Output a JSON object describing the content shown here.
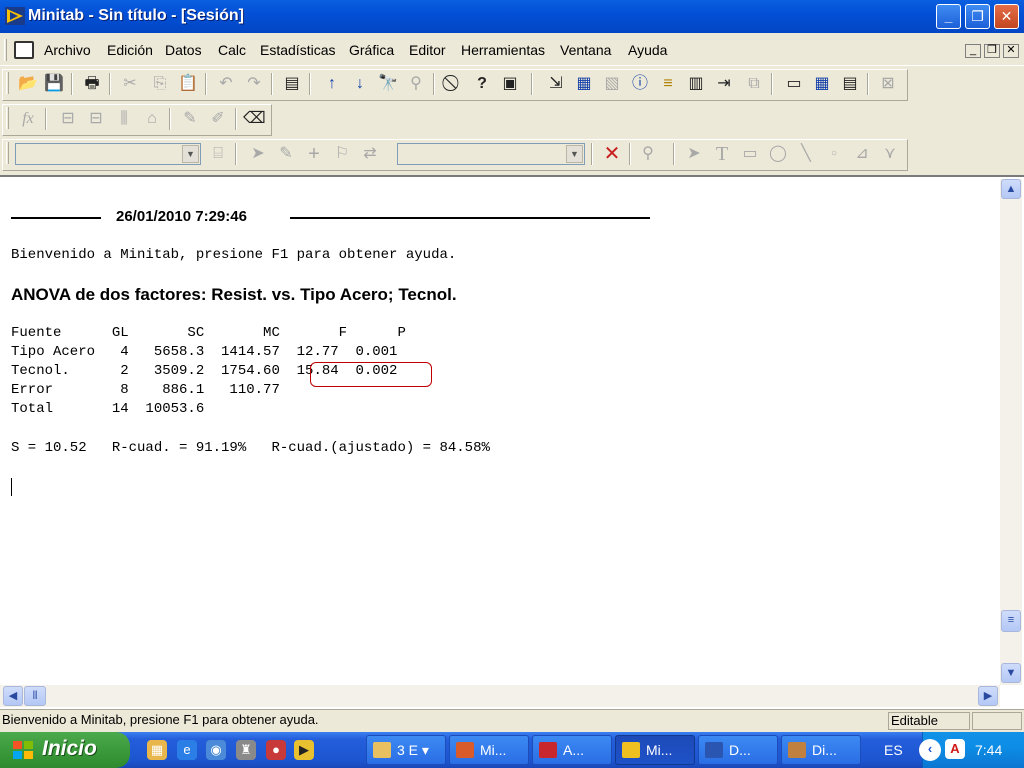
{
  "window": {
    "title": "Minitab - Sin título - [Sesión]",
    "caption_buttons": {
      "minimize": "_",
      "maximize": "❐",
      "close": "✕"
    }
  },
  "menu": {
    "items": [
      "Archivo",
      "Edición",
      "Datos",
      "Calc",
      "Estadísticas",
      "Gráfica",
      "Editor",
      "Herramientas",
      "Ventana",
      "Ayuda"
    ],
    "mdi_buttons": {
      "minimize": "_",
      "restore": "❐",
      "close": "✕"
    }
  },
  "toolbars": {
    "main_icons": [
      "open-icon",
      "save-icon",
      "print-icon",
      "cut-icon",
      "copy-icon",
      "paste-icon",
      "undo-icon",
      "redo-icon",
      "session-window-icon",
      "up-arrow-icon",
      "down-arrow-icon",
      "find-icon",
      "find-replace-icon",
      "cancel-icon",
      "help-icon",
      "manage-icon",
      "project-icon",
      "worksheet-icon",
      "graphs-icon",
      "info-icon",
      "history-icon",
      "related-icon",
      "layout-icon",
      "report-icon",
      "table-icon",
      "close-graphs-icon"
    ],
    "worksheet_icons": [
      "fx-icon",
      "insert-cells-icon",
      "insert-rows-icon",
      "insert-columns-icon",
      "move-columns-icon",
      "brush-icon",
      "edit-icon",
      "eraser-icon"
    ],
    "graph_icons": [
      "select-icon",
      "brush-graph-icon",
      "crosshair-icon",
      "flag-icon",
      "swap-icon",
      "delete-icon",
      "zoom-icon",
      "pointer-icon",
      "text-icon",
      "rectangle-icon",
      "ellipse-icon",
      "line-icon",
      "marker-icon",
      "polygon-icon",
      "polyline-icon"
    ]
  },
  "session": {
    "datetime": "26/01/2010 7:29:46",
    "welcome": "Bienvenido a Minitab, presione F1 para obtener ayuda.",
    "anova_title": "ANOVA de dos factores: Resist. vs. Tipo Acero; Tecnol.",
    "table": {
      "header": "Fuente      GL       SC       MC       F      P",
      "rows": [
        "Tipo Acero   4   5658.3  1414.57  12.77  0.001",
        "Tecnol.      2   3509.2  1754.60  15.84  0.002",
        "Error        8    886.1   110.77",
        "Total       14  10053.6"
      ]
    },
    "summary": "S = 10.52   R-cuad. = 91.19%   R-cuad.(ajustado) = 84.58%",
    "highlight_color": "#c00000"
  },
  "status_bar": {
    "message": "Bienvenido a Minitab, presione F1 para obtener ayuda.",
    "mode": "Editable"
  },
  "taskbar": {
    "start_label": "Inicio",
    "tasks": [
      {
        "label": "3 E",
        "icon": "folder-icon"
      },
      {
        "label": "Mi...",
        "icon": "presentation-icon"
      },
      {
        "label": "A...",
        "icon": "pdf-icon"
      },
      {
        "label": "Mi...",
        "icon": "minitab-icon"
      },
      {
        "label": "D...",
        "icon": "word-icon"
      },
      {
        "label": "Di...",
        "icon": "paint-icon"
      }
    ],
    "language": "ES",
    "clock": "7:44"
  }
}
